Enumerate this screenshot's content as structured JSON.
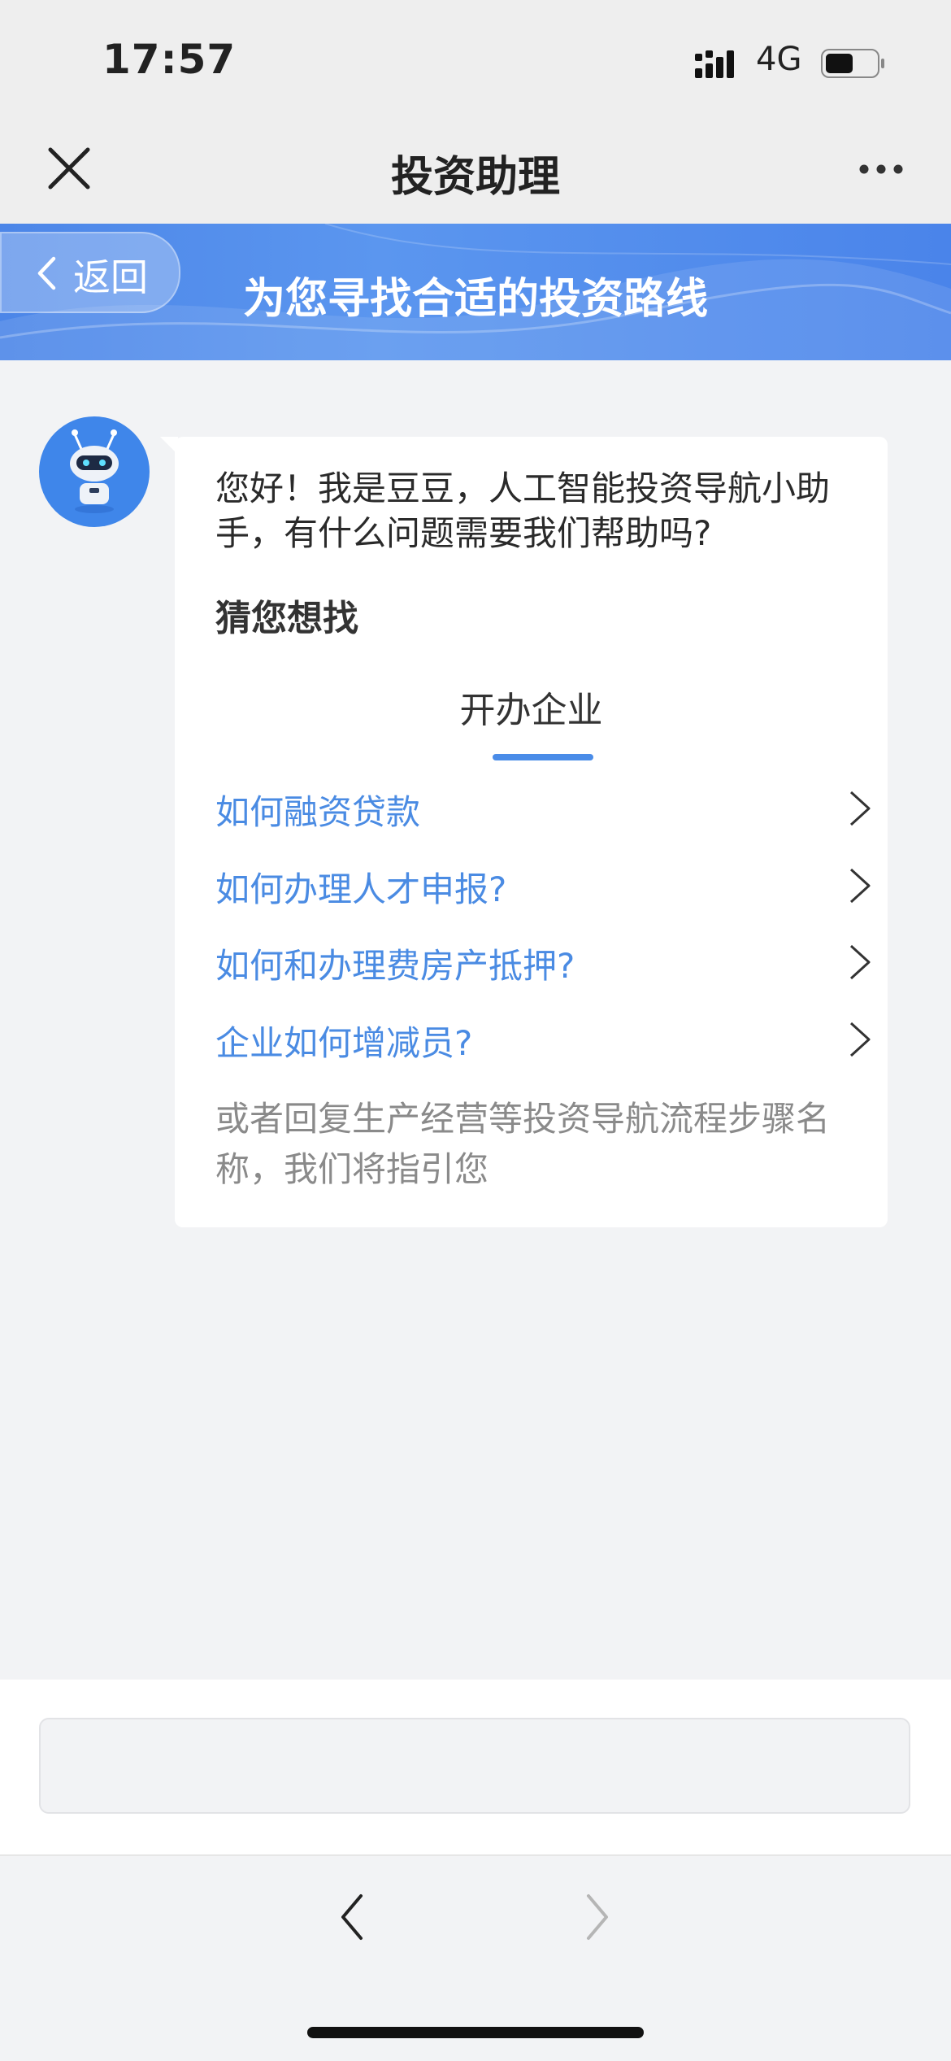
{
  "status_bar": {
    "time": "17:57",
    "network": "4G",
    "battery_level": 0.55
  },
  "nav": {
    "title": "投资助理",
    "close_icon": "close-icon",
    "more_icon": "more-dots-icon"
  },
  "banner": {
    "back_label": "返回",
    "title": "为您寻找合适的投资路线"
  },
  "chat": {
    "greeting": "您好！我是豆豆，人工智能投资导航小助手，有什么问题需要我们帮助吗?",
    "guess_title": "猜您想找",
    "tab_label": "开办企业",
    "questions": [
      {
        "label": "如何融资贷款"
      },
      {
        "label": "如何办理人才申报?"
      },
      {
        "label": "如何和办理费房产抵押?"
      },
      {
        "label": "企业如何增减员?"
      }
    ],
    "hint": "或者回复生产经营等投资导航流程步骤名称，我们将指引您"
  },
  "colors": {
    "accent": "#4a8be3",
    "banner": "#4c86e8",
    "background": "#f2f3f5"
  }
}
